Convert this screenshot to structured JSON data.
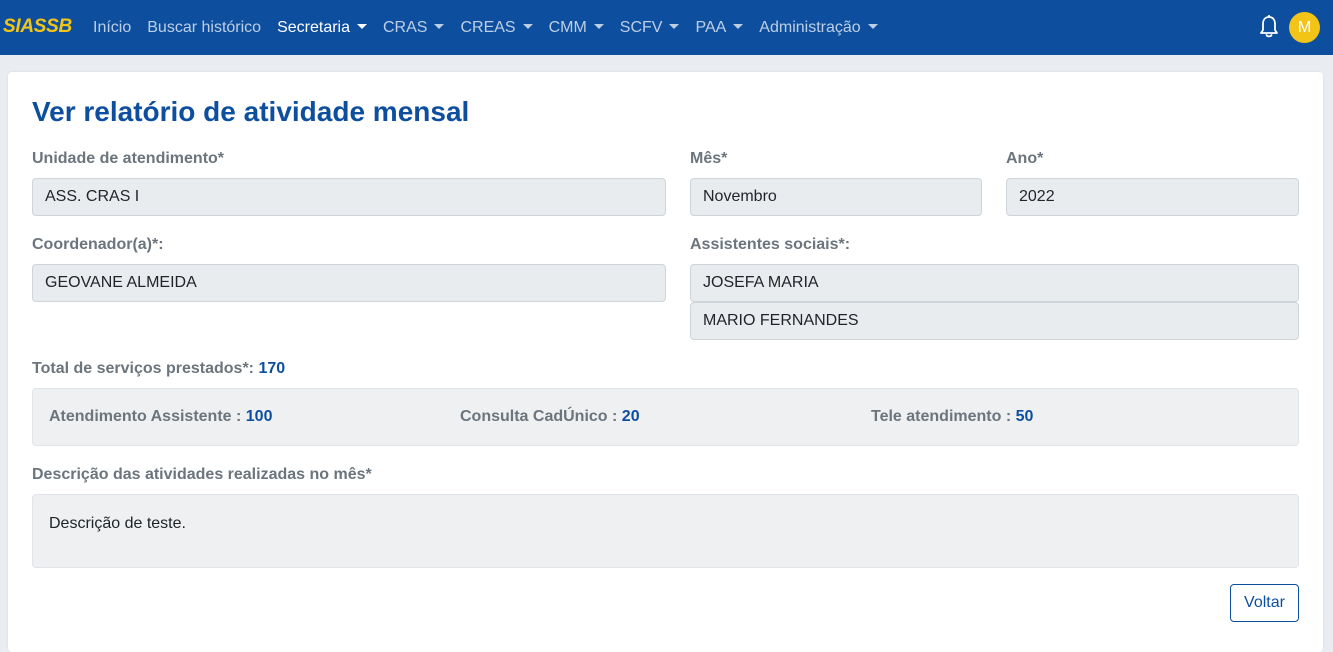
{
  "navbar": {
    "brand": "SIASSB",
    "items": [
      {
        "label": "Início",
        "dropdown": false,
        "active": false
      },
      {
        "label": "Buscar histórico",
        "dropdown": false,
        "active": false
      },
      {
        "label": "Secretaria",
        "dropdown": true,
        "active": true
      },
      {
        "label": "CRAS",
        "dropdown": true,
        "active": false
      },
      {
        "label": "CREAS",
        "dropdown": true,
        "active": false
      },
      {
        "label": "CMM",
        "dropdown": true,
        "active": false
      },
      {
        "label": "SCFV",
        "dropdown": true,
        "active": false
      },
      {
        "label": "PAA",
        "dropdown": true,
        "active": false
      },
      {
        "label": "Administração",
        "dropdown": true,
        "active": false
      }
    ],
    "notification_icon": "bell-icon",
    "avatar_initial": "M"
  },
  "colors": {
    "navbar_bg": "#0d4f9e",
    "brand": "#f2c417",
    "accent": "#0d4f9e",
    "field_bg": "#e9ecef"
  },
  "page": {
    "title": "Ver relatório de atividade mensal"
  },
  "form": {
    "unidade_label": "Unidade de atendimento*",
    "unidade_value": "ASS. CRAS I",
    "mes_label": "Mês*",
    "mes_value": "Novembro",
    "ano_label": "Ano*",
    "ano_value": "2022",
    "coordenador_label": "Coordenador(a)*:",
    "coordenador_value": "GEOVANE ALMEIDA",
    "assistentes_label": "Assistentes sociais*:",
    "assistentes": [
      "JOSEFA MARIA",
      "MARIO FERNANDES"
    ],
    "total_label": "Total de serviços prestados*:",
    "total_value": "170",
    "services": [
      {
        "label": "Atendimento Assistente :",
        "value": "100"
      },
      {
        "label": "Consulta CadÚnico :",
        "value": "20"
      },
      {
        "label": "Tele atendimento :",
        "value": "50"
      }
    ],
    "descricao_label": "Descrição das atividades realizadas no mês*",
    "descricao_value": "Descrição de teste."
  },
  "actions": {
    "voltar_label": "Voltar"
  }
}
